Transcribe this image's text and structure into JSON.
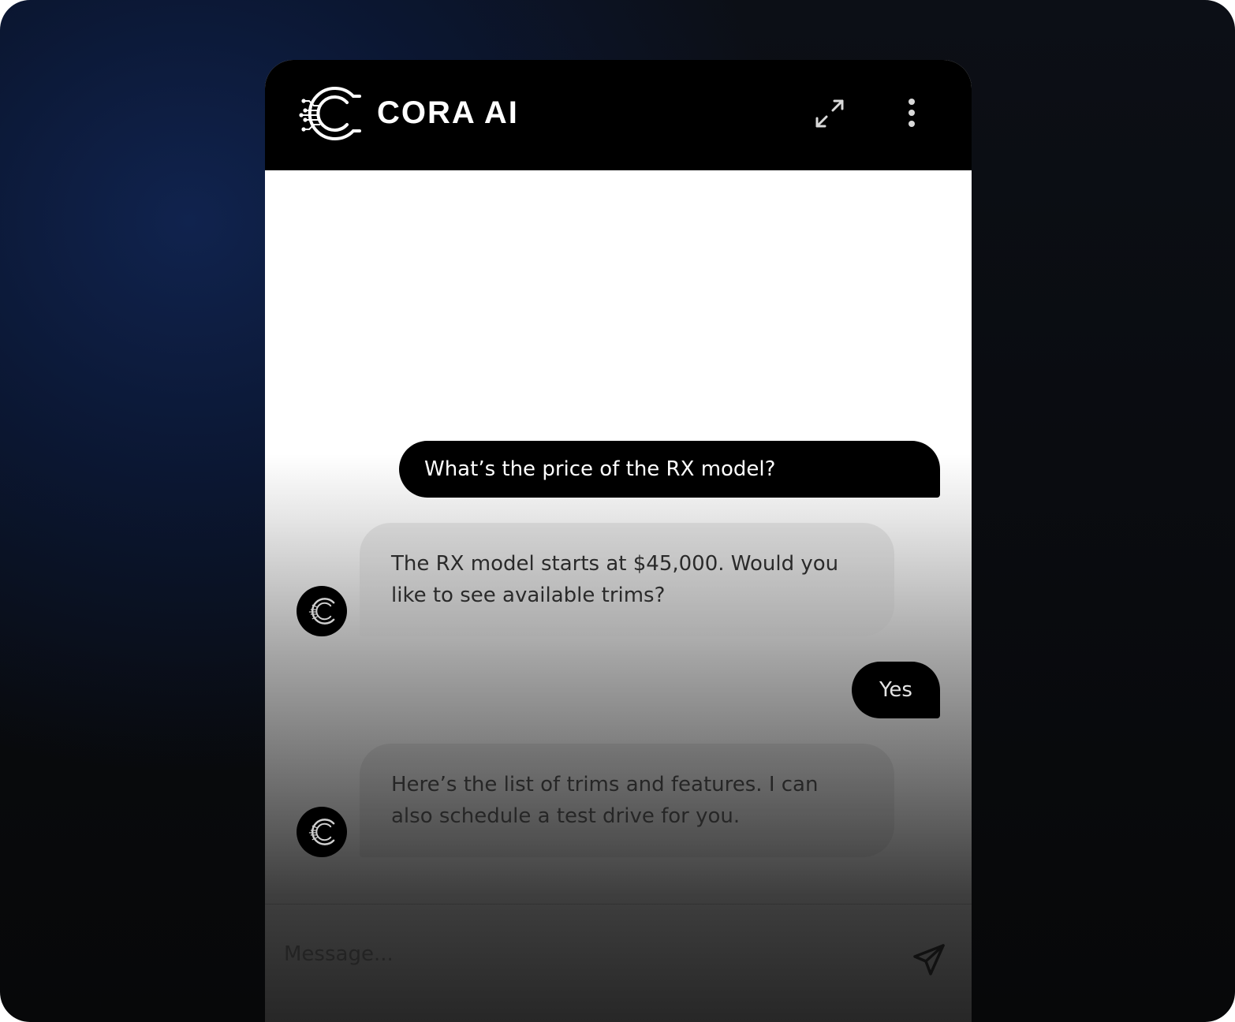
{
  "header": {
    "brand": "CORA AI",
    "logo_icon": "cora-logo-icon",
    "expand_icon": "expand-icon",
    "menu_icon": "more-vertical-icon"
  },
  "messages": [
    {
      "role": "user",
      "text": "What’s the price of the RX model?"
    },
    {
      "role": "bot",
      "text": "The RX model starts at $45,000. Would you like to see available trims?"
    },
    {
      "role": "user",
      "text": "Yes"
    },
    {
      "role": "bot",
      "text": "Here’s the list of trims and features. I can also schedule a test drive for you."
    }
  ],
  "composer": {
    "placeholder": "Message...",
    "value": "",
    "send_icon": "send-icon"
  },
  "colors": {
    "header_bg": "#000000",
    "user_bubble": "#000000",
    "page_bg_accent": "#10234e"
  }
}
